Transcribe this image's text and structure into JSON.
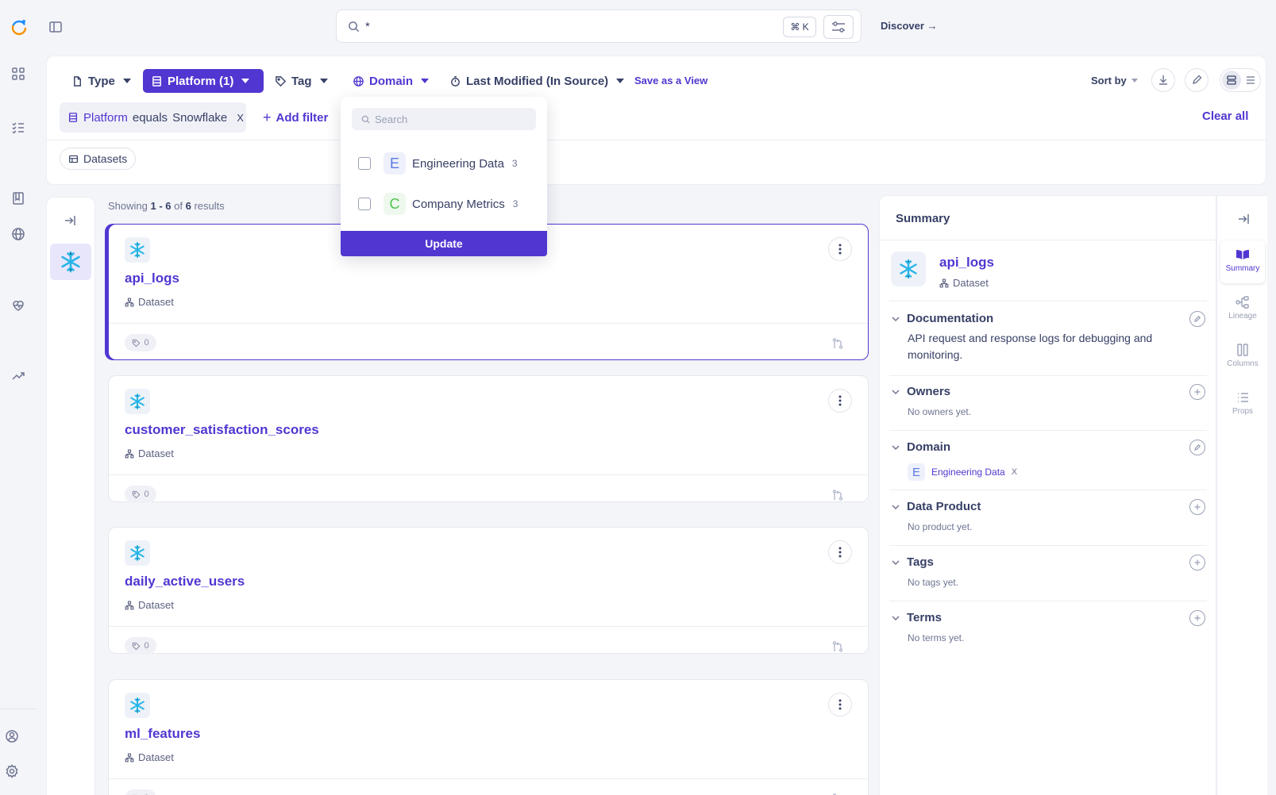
{
  "colors": {
    "accent": "#5236d1",
    "snowflake": "#29b5e8",
    "domain_e": "#5b7cdf",
    "domain_c": "#4ec44e"
  },
  "search": {
    "query": "*",
    "shortcut": "⌘ K"
  },
  "topnav": {
    "discover": "Discover →"
  },
  "filters": {
    "type": "Type",
    "platform": "Platform (1)",
    "tag": "Tag",
    "domain": "Domain",
    "last_modified": "Last Modified (In Source)",
    "save_view": "Save as a View",
    "sort_by": "Sort by",
    "active_filter": {
      "field": "Platform",
      "op": "equals",
      "value": "Snowflake",
      "remove": "X"
    },
    "add_filter": "Add filter",
    "clear_all": "Clear all",
    "entity_chip": "Datasets"
  },
  "domain_dropdown": {
    "search_placeholder": "Search",
    "options": [
      {
        "letter": "E",
        "label": "Engineering Data",
        "count": "3"
      },
      {
        "letter": "C",
        "label": "Company Metrics",
        "count": "3"
      }
    ],
    "update": "Update"
  },
  "results": {
    "showing_prefix": "Showing",
    "range": "1 - 6",
    "of": "of",
    "total": "6",
    "suffix": "results",
    "items": [
      {
        "name": "api_logs",
        "type": "Dataset",
        "tags": "0"
      },
      {
        "name": "customer_satisfaction_scores",
        "type": "Dataset",
        "tags": "0"
      },
      {
        "name": "daily_active_users",
        "type": "Dataset",
        "tags": "0"
      },
      {
        "name": "ml_features",
        "type": "Dataset",
        "tags": "0"
      }
    ]
  },
  "summary": {
    "header": "Summary",
    "entity_name": "api_logs",
    "entity_type": "Dataset",
    "documentation": {
      "title": "Documentation",
      "text": "API request and response logs for debugging and monitoring."
    },
    "owners": {
      "title": "Owners",
      "empty": "No owners yet."
    },
    "domain": {
      "title": "Domain",
      "letter": "E",
      "value": "Engineering Data",
      "remove": "X"
    },
    "data_product": {
      "title": "Data Product",
      "empty": "No product yet."
    },
    "tags": {
      "title": "Tags",
      "empty": "No tags yet."
    },
    "terms": {
      "title": "Terms",
      "empty": "No terms yet."
    }
  },
  "side_tabs": [
    "Summary",
    "Lineage",
    "Columns",
    "Props"
  ]
}
